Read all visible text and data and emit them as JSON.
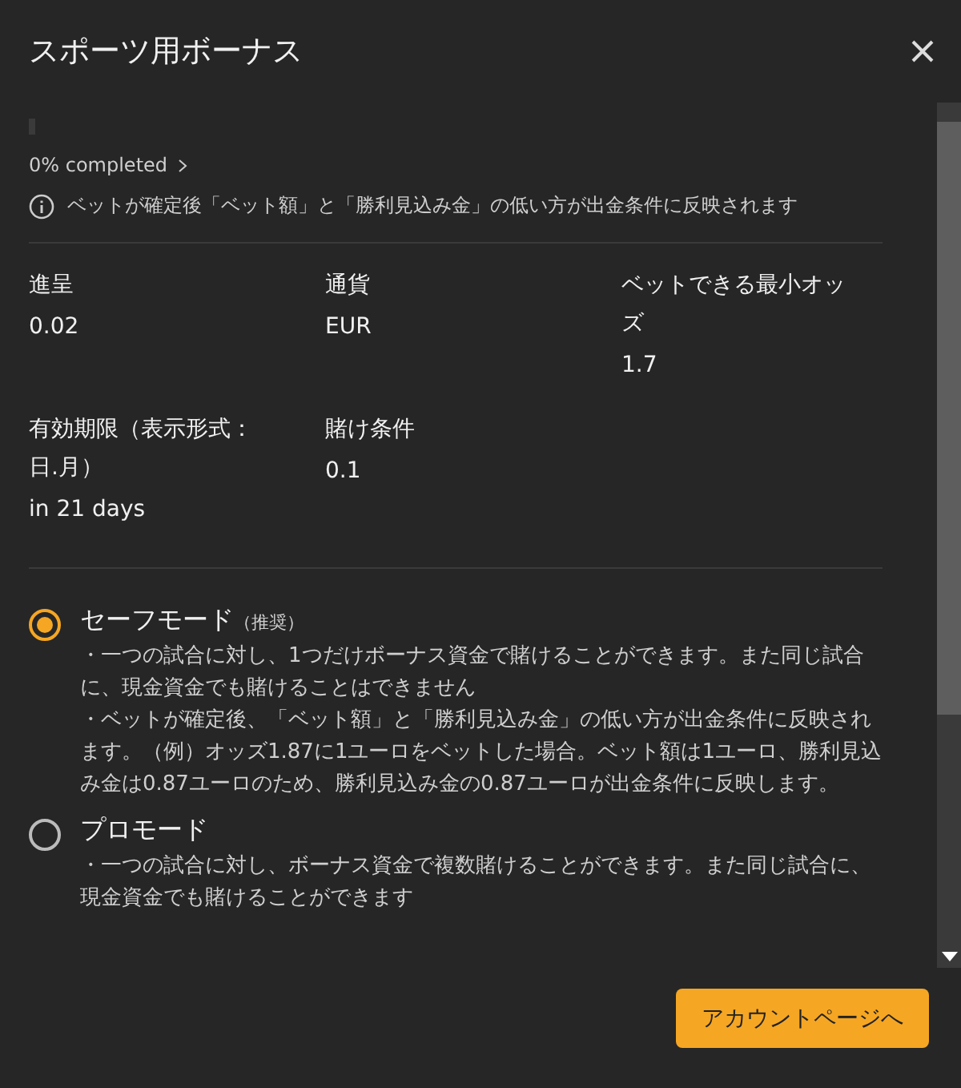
{
  "title": "スポーツ用ボーナス",
  "progress": {
    "label": "0% completed"
  },
  "info": "ベットが確定後「ベット額」と「勝利見込み金」の低い方が出金条件に反映されます",
  "stats": [
    {
      "label": "進呈",
      "value": "0.02"
    },
    {
      "label": "通貨",
      "value": "EUR"
    },
    {
      "label": "ベットできる最小オッズ",
      "value": "1.7"
    },
    {
      "label": "有効期限（表示形式：日.月）",
      "value": "in 21 days"
    },
    {
      "label": "賭け条件",
      "value": "0.1"
    }
  ],
  "modes": [
    {
      "name": "セーフモード",
      "note": "（推奨）",
      "selected": true,
      "lines": [
        "・一つの試合に対し、1つだけボーナス資金で賭けることができます。また同じ試合に、現金資金でも賭けることはできません",
        "・ベットが確定後、「ベット額」と「勝利見込み金」の低い方が出金条件に反映されます。（例）オッズ1.87に1ユーロをベットした場合。ベット額は1ユーロ、勝利見込み金は0.87ユーロのため、勝利見込み金の0.87ユーロが出金条件に反映します。"
      ]
    },
    {
      "name": "プロモード",
      "selected": false,
      "lines": [
        "・一つの試合に対し、ボーナス資金で複数賭けることができます。また同じ試合に、現金資金でも賭けることができます"
      ]
    }
  ],
  "button": "アカウントページへ"
}
